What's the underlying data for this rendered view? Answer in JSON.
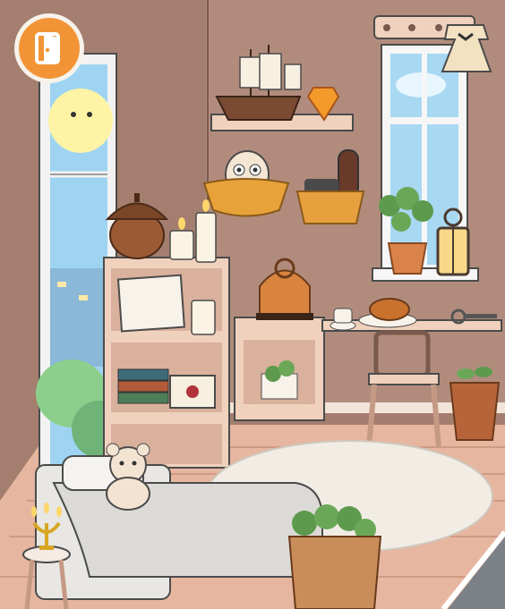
{
  "game": {
    "screen": "room",
    "exit_button": {
      "icon": "exit-door-icon",
      "label": ""
    }
  },
  "colors": {
    "wall": "#a47e6f",
    "wall_light": "#b18c7d",
    "floor": "#e7b6a0",
    "rug": "#f1ede5",
    "wood": "#f0d1bd",
    "exit_button": "#f29436"
  }
}
